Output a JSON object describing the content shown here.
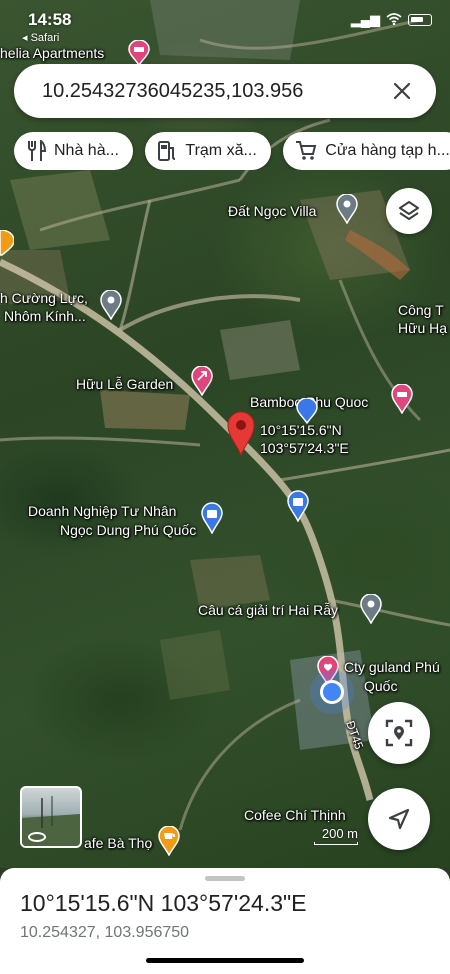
{
  "status_bar": {
    "time": "14:58",
    "back_app": "◂ Safari"
  },
  "search": {
    "value": "10.25432736045235,103.956",
    "clear_icon": "close-icon"
  },
  "chips": [
    {
      "label": "Nhà hà...",
      "icon": "restaurant-icon"
    },
    {
      "label": "Trạm xă...",
      "icon": "gas-station-icon"
    },
    {
      "label": "Cửa hàng tạp h...",
      "icon": "shopping-cart-icon"
    }
  ],
  "map": {
    "labels": {
      "ophelia": "helia Apartments",
      "dat_ngoc_villa": "Đất Ngọc Villa",
      "cuong_luc_1": "h Cường Lực,",
      "cuong_luc_2": "Nhôm Kính...",
      "cong_ty_1": "Công T",
      "cong_ty_2": "Hữu Hạ",
      "huu_le_garden": "Hữu Lễ Garden",
      "bamboo": "Bamboo Phu Quoc",
      "dropped_pin_1": "10°15'15.6\"N",
      "dropped_pin_2": "103°57'24.3\"E",
      "ngoc_dung_1": "Doanh Nghiệp Tư Nhân",
      "ngoc_dung_2": "Ngọc Dung Phú Quốc",
      "cau_ca": "Câu cá giải trí Hai Rẫy",
      "guland_1": "Cty guland Phú",
      "guland_2": "Quốc",
      "road_dt45": "ĐT45",
      "cofee_chi_thinh": "Cofee Chí Thịnh",
      "ba_tho": "afe Bà Thọ"
    },
    "scale_label": "200 m",
    "colors": {
      "red_pin": "#e53935",
      "pink_pin": "#e0457b",
      "blue_pin": "#3b78e7",
      "grey_pin": "#6d7b84",
      "cafe_pin": "#f29b16",
      "my_location": "#4285f4"
    }
  },
  "buttons": {
    "layers_icon": "layers-icon",
    "street_view_icon": "street-view-scan-icon",
    "navigate_icon": "navigation-arrow-icon"
  },
  "sheet": {
    "title": "10°15'15.6\"N 103°57'24.3\"E",
    "subtitle": "10.254327, 103.956750"
  }
}
